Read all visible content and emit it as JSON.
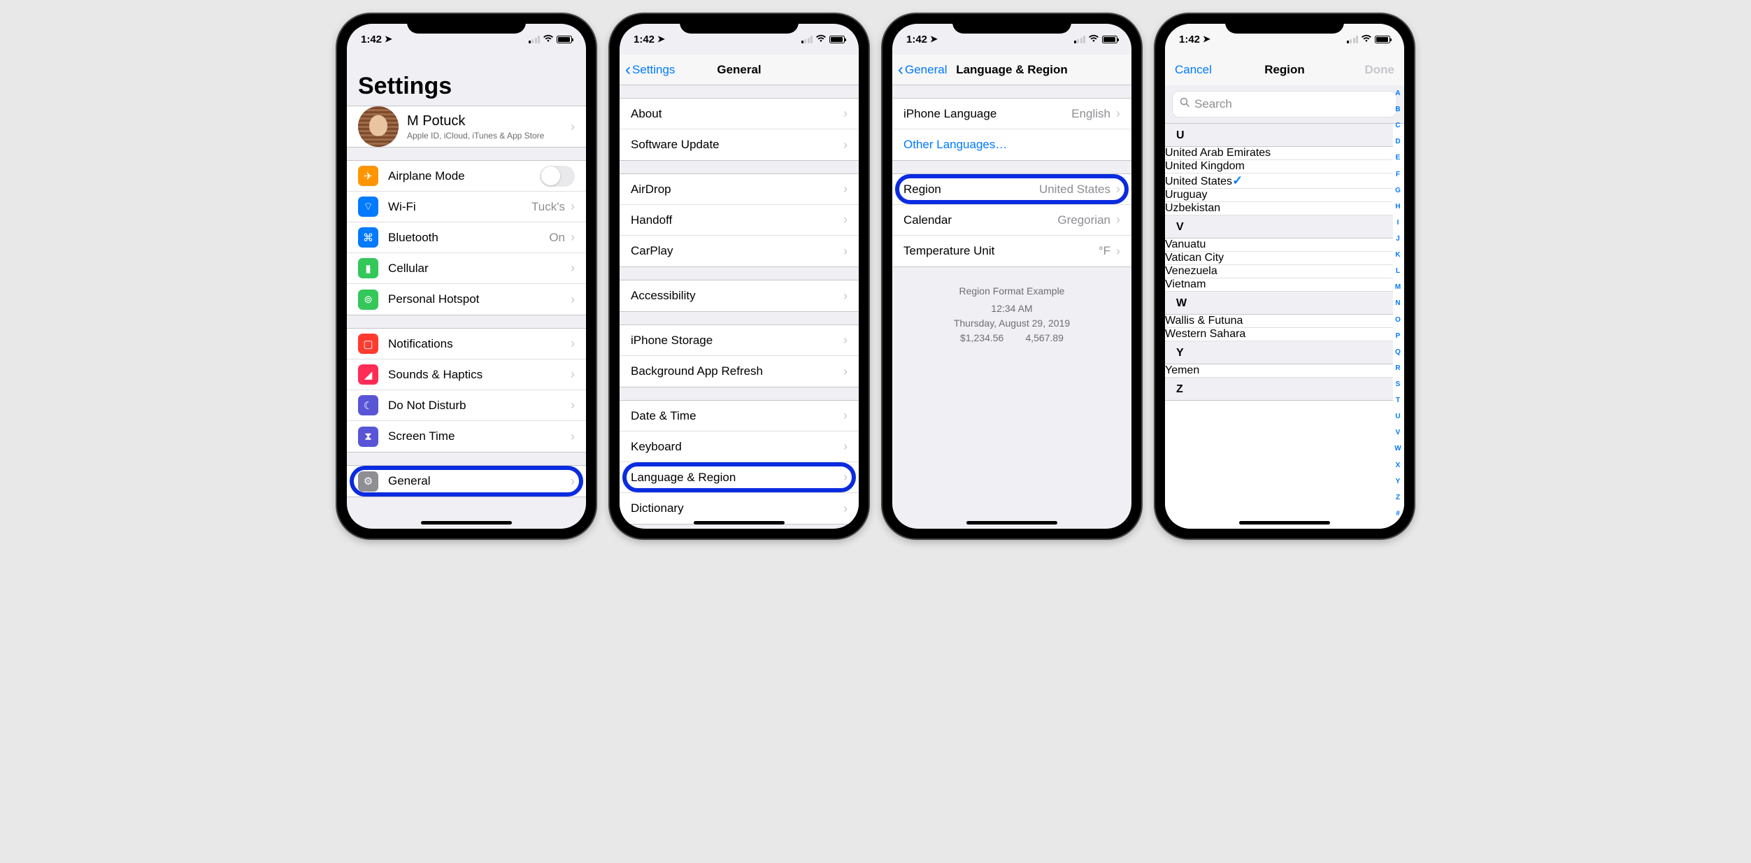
{
  "status": {
    "time": "1:42",
    "location_arrow": "➤"
  },
  "colors": {
    "ios_blue": "#007aff",
    "highlight_ring": "#0a2be0"
  },
  "phone1": {
    "title": "Settings",
    "appleid": {
      "name": "M Potuck",
      "sub": "Apple ID, iCloud, iTunes & App Store"
    },
    "rows_g1": [
      {
        "label": "Airplane Mode",
        "icon": "airplane",
        "toggle": false
      },
      {
        "label": "Wi-Fi",
        "icon": "wifi",
        "detail": "Tuck's"
      },
      {
        "label": "Bluetooth",
        "icon": "bluetooth",
        "detail": "On"
      },
      {
        "label": "Cellular",
        "icon": "cellular"
      },
      {
        "label": "Personal Hotspot",
        "icon": "hotspot"
      }
    ],
    "rows_g2": [
      {
        "label": "Notifications",
        "icon": "notifications"
      },
      {
        "label": "Sounds & Haptics",
        "icon": "sounds"
      },
      {
        "label": "Do Not Disturb",
        "icon": "dnd"
      },
      {
        "label": "Screen Time",
        "icon": "screentime"
      }
    ],
    "rows_g3": [
      {
        "label": "General",
        "icon": "general",
        "highlighted": true
      }
    ]
  },
  "phone2": {
    "back": "Settings",
    "title": "General",
    "g1": [
      "About",
      "Software Update"
    ],
    "g2": [
      "AirDrop",
      "Handoff",
      "CarPlay"
    ],
    "g3": [
      "Accessibility"
    ],
    "g4": [
      "iPhone Storage",
      "Background App Refresh"
    ],
    "g5": [
      "Date & Time",
      "Keyboard",
      "Language & Region",
      "Dictionary"
    ],
    "highlight_label": "Language & Region"
  },
  "phone3": {
    "back": "General",
    "title": "Language & Region",
    "g1": [
      {
        "label": "iPhone Language",
        "detail": "English"
      },
      {
        "label": "Other Languages…",
        "link": true
      }
    ],
    "g2": [
      {
        "label": "Region",
        "detail": "United States",
        "highlighted": true
      },
      {
        "label": "Calendar",
        "detail": "Gregorian"
      },
      {
        "label": "Temperature Unit",
        "detail": "°F"
      }
    ],
    "example": {
      "header": "Region Format Example",
      "line1": "12:34 AM",
      "line2": "Thursday, August 29, 2019",
      "line3": "$1,234.56        4,567.89"
    }
  },
  "phone4": {
    "cancel": "Cancel",
    "title": "Region",
    "done": "Done",
    "search_placeholder": "Search",
    "sections": [
      {
        "header": "U",
        "items": [
          {
            "label": "United Arab Emirates"
          },
          {
            "label": "United Kingdom"
          },
          {
            "label": "United States",
            "selected": true
          },
          {
            "label": "Uruguay"
          },
          {
            "label": "Uzbekistan"
          }
        ]
      },
      {
        "header": "V",
        "items": [
          {
            "label": "Vanuatu"
          },
          {
            "label": "Vatican City"
          },
          {
            "label": "Venezuela"
          },
          {
            "label": "Vietnam"
          }
        ]
      },
      {
        "header": "W",
        "items": [
          {
            "label": "Wallis & Futuna"
          },
          {
            "label": "Western Sahara"
          }
        ]
      },
      {
        "header": "Y",
        "items": [
          {
            "label": "Yemen"
          }
        ]
      },
      {
        "header": "Z",
        "items": []
      }
    ],
    "index": [
      "A",
      "B",
      "C",
      "D",
      "E",
      "F",
      "G",
      "H",
      "I",
      "J",
      "K",
      "L",
      "M",
      "N",
      "O",
      "P",
      "Q",
      "R",
      "S",
      "T",
      "U",
      "V",
      "W",
      "X",
      "Y",
      "Z",
      "#"
    ]
  }
}
